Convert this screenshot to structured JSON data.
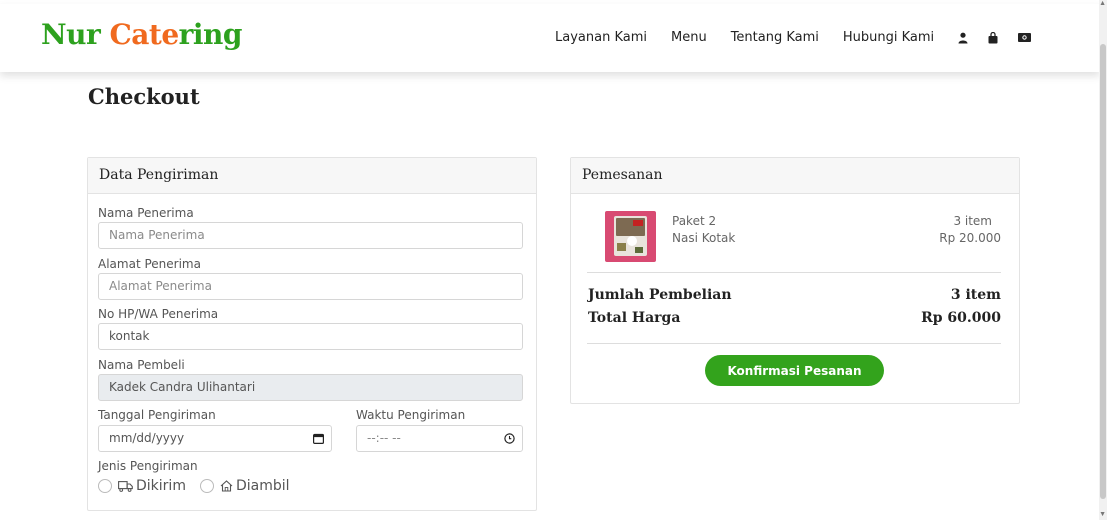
{
  "brand": {
    "part1": "Nur ",
    "part2": "Cate",
    "part3": "ring"
  },
  "nav": {
    "links": [
      "Layanan Kami",
      "Menu",
      "Tentang Kami",
      "Hubungi Kami"
    ],
    "icons": [
      "user-icon",
      "shopping-bag-icon",
      "cash-icon"
    ]
  },
  "page": {
    "title": "Checkout"
  },
  "shipping": {
    "header": "Data Pengiriman",
    "recipient_name": {
      "label": "Nama Penerima",
      "placeholder": "Nama Penerima"
    },
    "recipient_address": {
      "label": "Alamat Penerima",
      "placeholder": "Alamat Penerima"
    },
    "recipient_phone": {
      "label": "No HP/WA Penerima",
      "value": "kontak"
    },
    "buyer_name": {
      "label": "Nama Pembeli",
      "value": "Kadek Candra Ulihantari"
    },
    "date": {
      "label": "Tanggal Pengiriman",
      "placeholder": "mm/dd/yyyy"
    },
    "time": {
      "label": "Waktu Pengiriman",
      "placeholder": "--:-- --"
    },
    "method": {
      "label": "Jenis Pengiriman",
      "options": [
        "Dikirim",
        "Diambil"
      ]
    }
  },
  "order": {
    "header": "Pemesanan",
    "item": {
      "name": "Paket 2",
      "category": "Nasi Kotak",
      "qty": "3 item",
      "price": "Rp 20.000"
    },
    "total_qty_label": "Jumlah Pembelian",
    "total_qty": "3 item",
    "total_price_label": "Total Harga",
    "total_price": "Rp 60.000",
    "confirm_label": "Konfirmasi Pesanan"
  },
  "colors": {
    "brand_green": "#2da11e",
    "brand_orange": "#f06a1f",
    "button_green": "#33a31c"
  }
}
